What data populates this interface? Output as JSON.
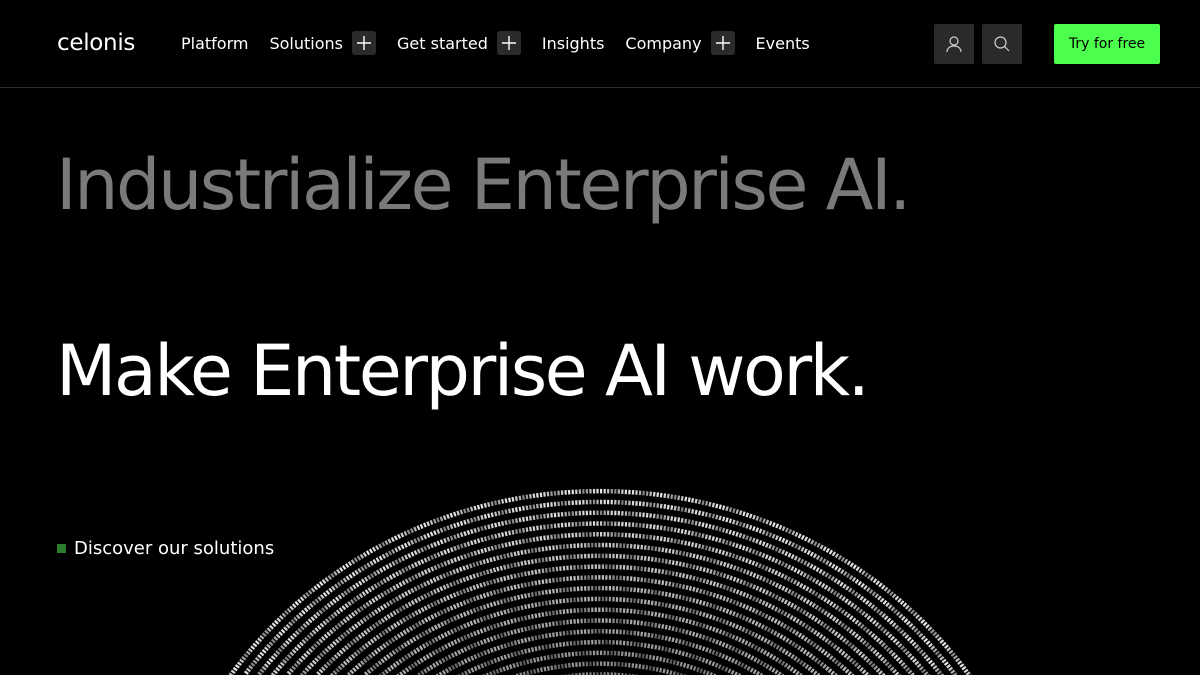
{
  "header": {
    "logo": "celonis",
    "nav": [
      {
        "label": "Platform",
        "expandable": false
      },
      {
        "label": "Solutions",
        "expandable": true
      },
      {
        "label": "Get started",
        "expandable": true
      },
      {
        "label": "Insights",
        "expandable": false
      },
      {
        "label": "Company",
        "expandable": true
      },
      {
        "label": "Events",
        "expandable": false
      }
    ],
    "icons": {
      "account": "user-icon",
      "search": "search-icon",
      "expand": "plus-icon"
    },
    "cta_label": "Try for free"
  },
  "hero": {
    "headline_primary": "Industrialize Enterprise AI.",
    "headline_secondary": "Make Enterprise AI work.",
    "link_label": "Discover our solutions"
  },
  "colors": {
    "background": "#000000",
    "accent": "#4dff4d",
    "headline_grey": "#7a7a7a",
    "bullet": "#2e7d2e"
  }
}
